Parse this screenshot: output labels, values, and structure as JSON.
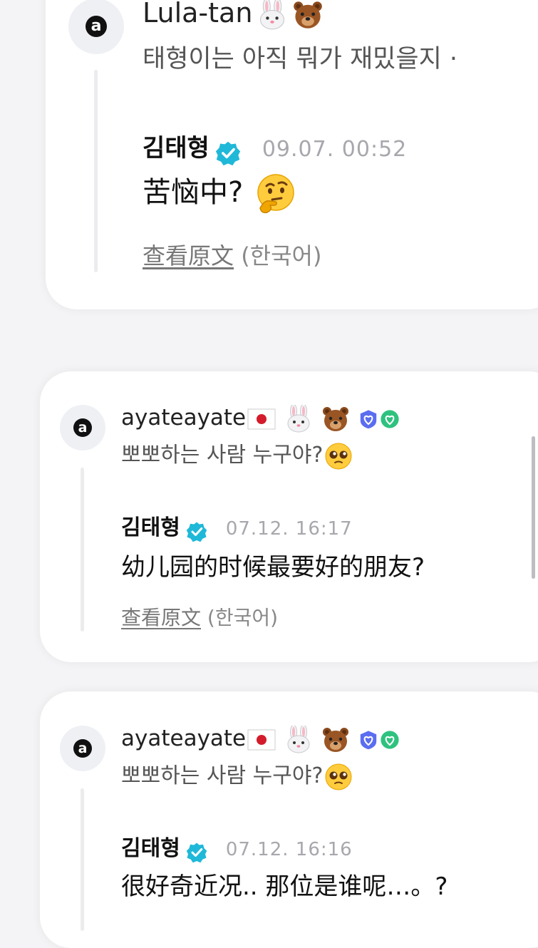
{
  "posts": [
    {
      "user": "Lula-tan",
      "user_emojis": [
        "rabbit-face",
        "bear-face"
      ],
      "comment": "태형이는 아직 뭐가 재밌을지 ·",
      "artist": "김태형",
      "time": "09.07. 00:52",
      "reply": "苦恼中?",
      "reply_emoji": "thinking-face",
      "translate_link": "查看原文",
      "translate_lang": "(한국어)"
    },
    {
      "user": "ayateayate",
      "user_emojis": [
        "japan-flag",
        "rabbit-face",
        "bear-face",
        "purple-heart-badge",
        "green-heart-badge"
      ],
      "comment": "뽀뽀하는 사람 누구야?",
      "comment_emoji": "pleading-face",
      "artist": "김태형",
      "time": "07.12. 16:17",
      "reply": "幼儿园的时候最要好的朋友?",
      "translate_link": "查看原文",
      "translate_lang": "(한국어)"
    },
    {
      "user": "ayateayate",
      "user_emojis": [
        "japan-flag",
        "rabbit-face",
        "bear-face",
        "purple-heart-badge",
        "green-heart-badge"
      ],
      "comment": "뽀뽀하는 사람 누구야?",
      "comment_emoji": "pleading-face",
      "artist": "김태형",
      "time": "07.12. 16:16",
      "reply": "很好奇近况.. 那位是谁呢…。?"
    }
  ],
  "avatar_letter": "a",
  "colors": {
    "background": "#f4f4f6",
    "card": "#ffffff",
    "verified": "#1fb8d8",
    "timestamp": "#a7a7ad",
    "thread_line": "#ececef"
  }
}
